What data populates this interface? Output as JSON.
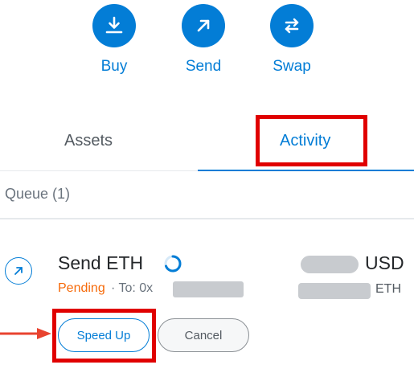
{
  "actions": [
    {
      "label": "Buy",
      "icon": "download-icon"
    },
    {
      "label": "Send",
      "icon": "arrow-up-right-icon"
    },
    {
      "label": "Swap",
      "icon": "swap-icon"
    }
  ],
  "tabs": {
    "assets": "Assets",
    "activity": "Activity",
    "active": "activity"
  },
  "queue": {
    "label": "Queue (1)"
  },
  "transaction": {
    "title": "Send ETH",
    "status": "Pending",
    "to_prefix": "· To: 0x",
    "fiat_currency": "USD",
    "crypto_currency": "ETH",
    "icon": "arrow-up-right-icon",
    "status_icon": "spinner-icon"
  },
  "buttons": {
    "speed_up": "Speed Up",
    "cancel": "Cancel"
  },
  "colors": {
    "accent": "#037dd6",
    "pending": "#f66a0a",
    "highlight": "#e00000"
  }
}
